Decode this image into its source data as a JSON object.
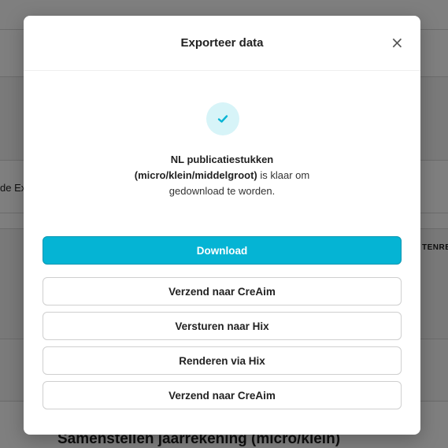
{
  "background": {
    "fragment_left": "de Ex",
    "fragment_right": "TENRE",
    "heading": "Samenstellen jaarrekening (micro/klein)"
  },
  "modal": {
    "title": "Exporteer data",
    "close_label": "×",
    "message": {
      "bold_line1": "NL publicatiestukken",
      "bold_line2": "(micro/klein/middelgroot)",
      "rest_line2": " is klaar om",
      "line3": "gedownload te worden."
    },
    "buttons": {
      "download": "Download",
      "send_creaim_1": "Verzend naar CreAim",
      "send_hix": "Versturen naar Hix",
      "render_hix": "Renderen via Hix",
      "send_creaim_2": "Verzend naar CreAim"
    },
    "accent_color": "#05b4d4",
    "success_bg": "#d7f4f8"
  }
}
